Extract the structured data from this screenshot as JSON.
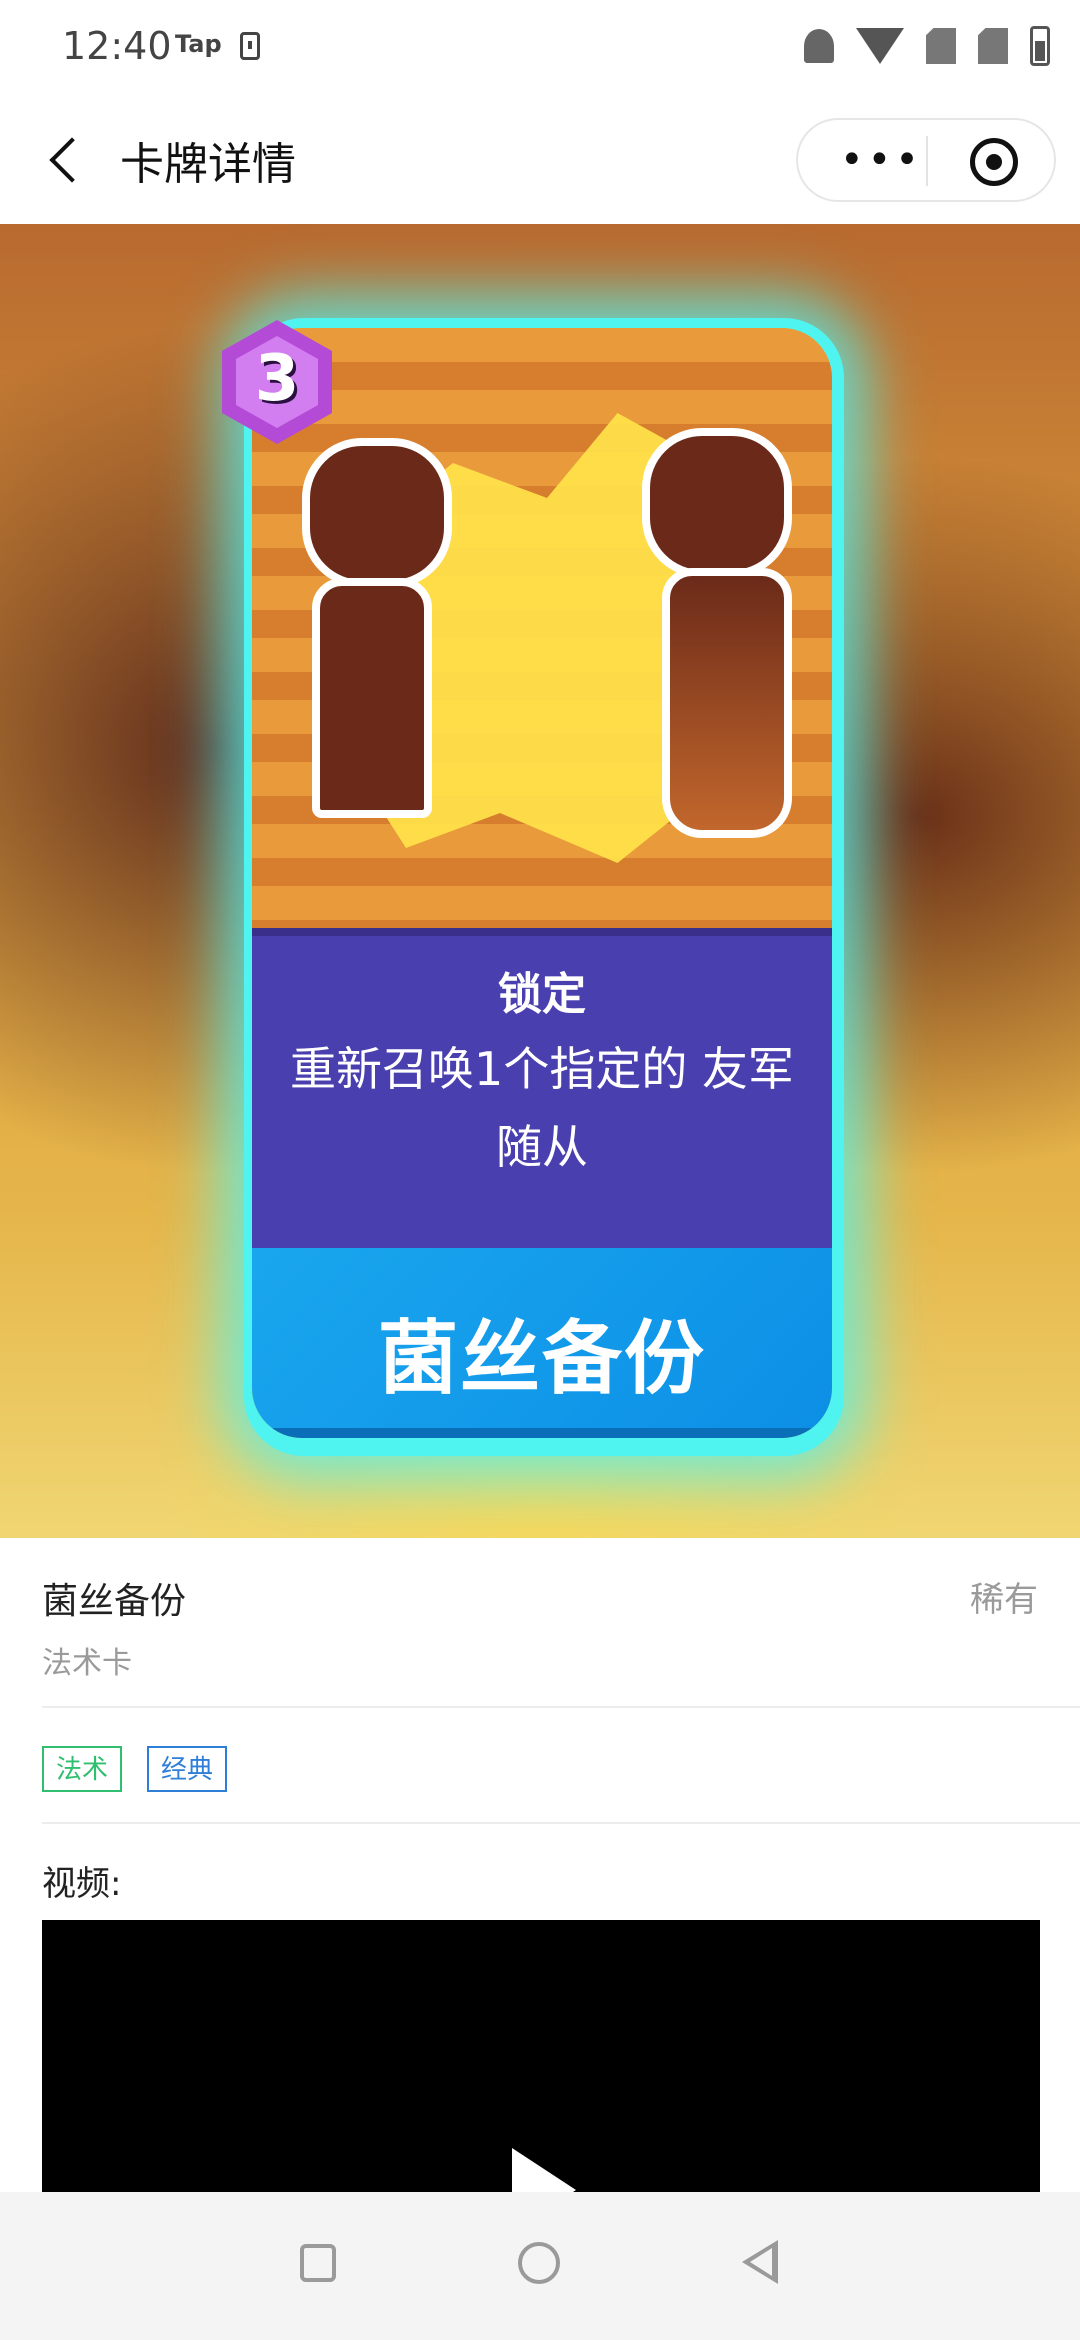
{
  "status_bar": {
    "time": "12:40",
    "app_label": "Tap"
  },
  "nav": {
    "title": "卡牌详情",
    "more_symbol": "•••"
  },
  "card": {
    "cost": "3",
    "keyword": "锁定",
    "description": "重新召唤1个指定的 友军随从",
    "name": "菌丝备份"
  },
  "info": {
    "name": "菌丝备份",
    "rarity": "稀有",
    "type": "法术卡",
    "tags": [
      "法术",
      "经典"
    ],
    "video_label": "视频:"
  },
  "colors": {
    "glow": "#4ff3f0",
    "desc_panel": "#4a3fae",
    "name_panel": "#1aa6ee",
    "tag_green": "#2fbf6f",
    "tag_blue": "#2f7fd9"
  },
  "icons": {
    "back": "chevron-left-icon",
    "more": "more-dots-icon",
    "close_target": "target-icon",
    "play": "play-icon"
  }
}
